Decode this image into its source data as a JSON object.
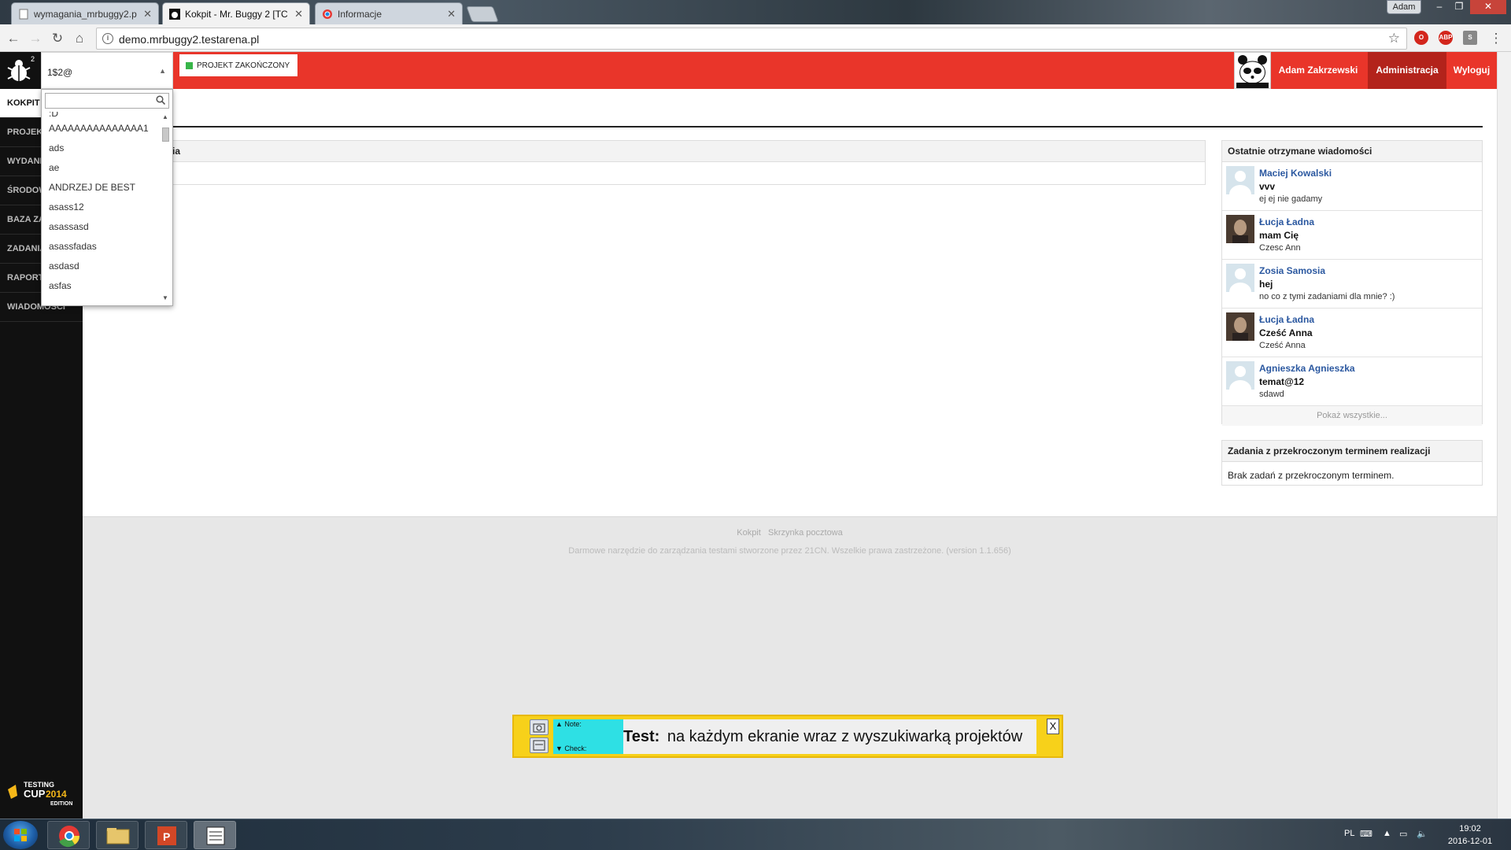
{
  "browser": {
    "tabs": [
      {
        "title": "wymagania_mrbuggy2.p",
        "active": false
      },
      {
        "title": "Kokpit - Mr. Buggy 2 [TC",
        "active": true
      },
      {
        "title": "Informacje",
        "active": false
      }
    ],
    "tab_close": "✕",
    "os_user": "Adam",
    "url": "demo.mrbuggy2.testarena.pl"
  },
  "app": {
    "project_selector_value": "1$2@",
    "project_status": "PROJEKT ZAKOŃCZONY",
    "user_name": "Adam Zakrzewski",
    "admin_label": "Administracja",
    "logout_label": "Wyloguj"
  },
  "sidebar": {
    "items": [
      {
        "label": "KOKPIT",
        "active": true
      },
      {
        "label": "PROJEKTY"
      },
      {
        "label": "WYDANIA"
      },
      {
        "label": "ŚRODOWISKA"
      },
      {
        "label": "BAZA ZADAŃ"
      },
      {
        "label": "ZADANIA"
      },
      {
        "label": "RAPORTY"
      },
      {
        "label": "WIADOMOŚCI"
      }
    ],
    "badge_line1": "TESTING",
    "badge_line2": "CUP",
    "badge_year": "2014",
    "badge_line3": "EDITION"
  },
  "dropdown": {
    "search_value": "",
    "items": [
      ":D",
      "AAAAAAAAAAAAAAA1",
      "ads",
      "ae",
      "ANDRZEJ DE BEST",
      "asass12",
      "asassasd",
      "asassfadas",
      "asdasd",
      "asfas"
    ]
  },
  "left_panel": {
    "title_partial": "ania"
  },
  "messages_panel": {
    "title": "Ostatnie otrzymane wiadomości",
    "messages": [
      {
        "name": "Maciej Kowalski",
        "subject": "vvv",
        "text": "ej ej nie gadamy",
        "photo": false
      },
      {
        "name": "Łucja Ładna",
        "subject": "mam Cię",
        "text": "Czesc Ann",
        "photo": true
      },
      {
        "name": "Zosia Samosia",
        "subject": "hej",
        "text": "no co z tymi zadaniami dla mnie? :)",
        "photo": false
      },
      {
        "name": "Łucja Ładna",
        "subject": "Cześć Anna",
        "text": "Cześć Anna",
        "photo": true
      },
      {
        "name": "Agnieszka Agnieszka",
        "subject": "temat@12",
        "text": "sdawd",
        "photo": false
      }
    ],
    "show_all": "Pokaż wszystkie..."
  },
  "overdue_panel": {
    "title": "Zadania z przekroczonym terminem realizacji",
    "empty_text": "Brak zadań z przekroczonym terminem."
  },
  "footer": {
    "link1": "Kokpit",
    "link2": "Skrzynka pocztowa",
    "copyright": "Darmowe narzędzie do zarządzania testami stworzone przez 21CN. Wszelkie prawa zastrzeżone. (version 1.1.656)"
  },
  "note_widget": {
    "note_label": "▲ Note:",
    "check_label": "▼ Check:",
    "prefix": "Test:",
    "text": "na każdym ekranie wraz z wyszukiwarką projektów",
    "close": "X"
  },
  "taskbar": {
    "lang": "PL",
    "time": "19:02",
    "date": "2016-12-01"
  },
  "colors": {
    "topbar_red": "#e9352a",
    "admin_active": "#b3231b",
    "status_green": "#38b549",
    "link_blue": "#2b58a0",
    "note_yellow": "#f7d11a",
    "note_cyan": "#2ee0e4"
  }
}
